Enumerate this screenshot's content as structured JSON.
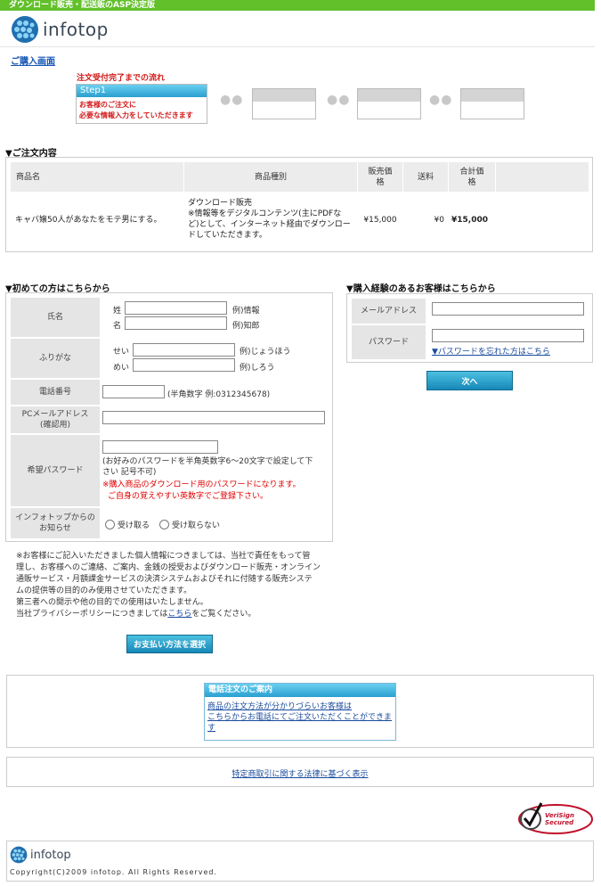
{
  "topbar": {
    "text": "ダウンロード販売・配送販のASP決定版"
  },
  "brand": {
    "name": "infotop"
  },
  "page_title": "ご購入画面",
  "flow": {
    "title": "注文受付完了までの流れ",
    "step1_label": "Step1",
    "step1_text1": "お客様のご注文に",
    "step1_text2": "必要な情報入力をしていただきます"
  },
  "order": {
    "section_title": "▼ご注文内容",
    "headers": {
      "name": "商品名",
      "type": "商品種別",
      "price1": "販売価",
      "price2": "格",
      "shipping": "送料",
      "total1": "合計価",
      "total2": "格"
    },
    "row": {
      "name": "キャバ嬢50人があなたをモテ男にする。",
      "type1": "ダウンロード販売",
      "type2": "※情報等をデジタルコンテンツ(主にPDFな",
      "type3": "ど)として、インターネット経由でダウンロー",
      "type4": "ドしていただきます。",
      "price": "¥15,000",
      "shipping": "¥0",
      "total": "¥15,000"
    }
  },
  "new_customer": {
    "section_title": "▼初めての方はこちらから",
    "name_label": "氏名",
    "sei": "姓",
    "mei": "名",
    "sei_example": "例)情報",
    "mei_example": "例)知郎",
    "furigana_label": "ふりがな",
    "sei_kana": "せい",
    "mei_kana": "めい",
    "sei_kana_example": "例)じょうほう",
    "mei_kana_example": "例)しろう",
    "phone_label": "電話番号",
    "phone_hint": "(半角数字  例:0312345678)",
    "email_label1": "PCメールアドレス",
    "email_label2": "(確認用)",
    "password_label": "希望パスワード",
    "password_hint1": "(お好みのパスワードを半角英数字6～20文字で設定して下",
    "password_hint2": "さい  記号不可)",
    "password_warn1": "※購入商品のダウンロード用のパスワードになります。",
    "password_warn2": "ご自身の覚えやすい英数字でご登録下さい。",
    "notice_label1": "インフォトップからの",
    "notice_label2": "お知らせ",
    "receive": "受け取る",
    "not_receive": "受け取らない"
  },
  "member": {
    "section_title": "▼購入経験のあるお客様はこちらから",
    "email_label": "メールアドレス",
    "password_label": "パスワード",
    "forgot_link": "▼パスワードを忘れた方はこちら",
    "next_button": "次へ"
  },
  "privacy": {
    "line1": "※お客様にご記入いただきました個人情報につきましては、当社で責任をもって管",
    "line2": "理し、お客様へのご連絡、ご案内、金銭の授受およびダウンロード販売・オンライン",
    "line3": "通販サービス・月額課金サービスの決済システムおよびそれに付随する販売システ",
    "line4": "ムの提供等の目的のみ使用させていただきます。",
    "line5": "第三者への開示や他の目的での使用はいたしません。",
    "line6_pre": "当社プライバシーポリシーにつきましては",
    "line6_link": "こちら",
    "line6_post": "をご覧ください。"
  },
  "payment_button": "お支払い方法を選択",
  "phone_order": {
    "title": "電話注文のご案内",
    "link1": "商品の注文方法が分かりづらいお客様は",
    "link2": "こちらからお電話にてご注文いただくことができま",
    "link3": "す"
  },
  "law_link": "特定商取引に関する法律に基づく表示",
  "verisign": {
    "line1": "VeriSign",
    "line2": "Secured"
  },
  "footer": {
    "copyright": "Copyright(C)2009 infotop. All Rights Reserved."
  }
}
